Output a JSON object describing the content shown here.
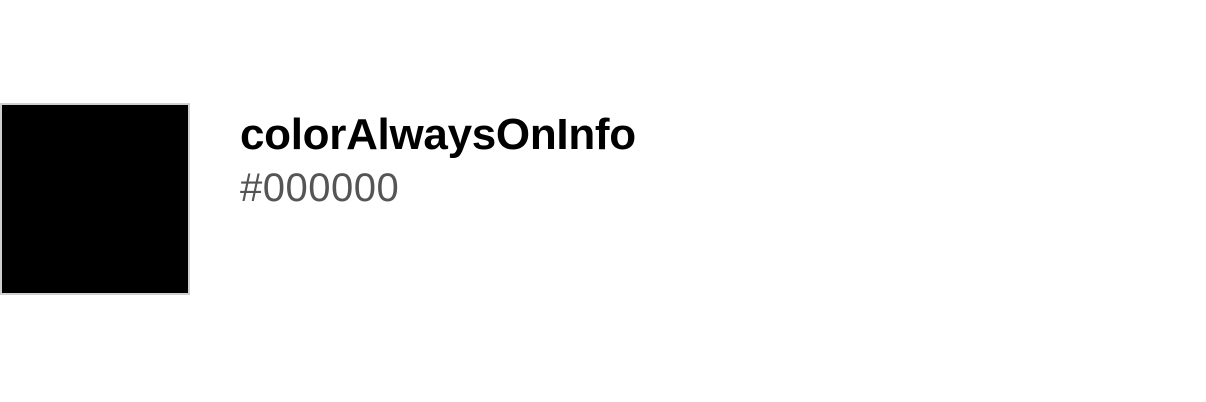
{
  "swatch": {
    "name": "colorAlwaysOnInfo",
    "value": "#000000",
    "fill_color": "#000000",
    "border_color": "#d0d0d0"
  }
}
